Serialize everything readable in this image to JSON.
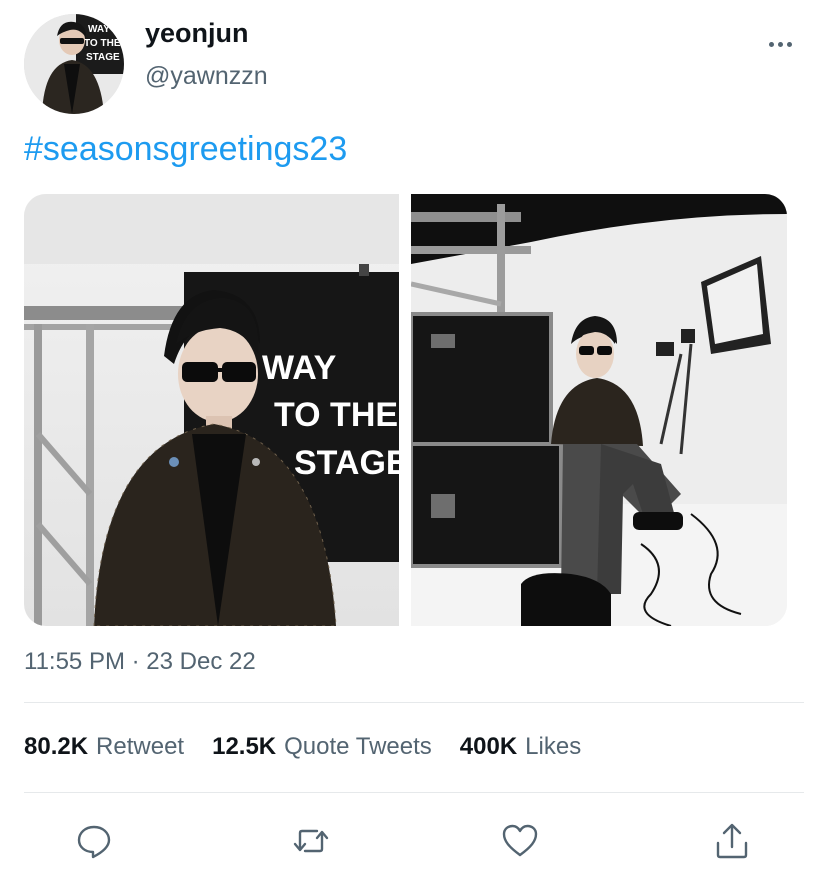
{
  "user": {
    "display_name": "yeonjun",
    "handle": "@yawnzzn",
    "avatar_backdrop_text": [
      "WAY",
      "TO THE",
      "STAGE"
    ]
  },
  "tweet": {
    "text": "#seasonsgreetings23",
    "timestamp": "11:55 PM · 23 Dec 22"
  },
  "media": {
    "photos": [
      {
        "banner_lines": [
          "WAY",
          "TO THE",
          "STAGE"
        ]
      },
      {
        "banner_lines": []
      }
    ]
  },
  "stats": {
    "retweets_count": "80.2K",
    "retweets_label": "Retweet",
    "quotes_count": "12.5K",
    "quotes_label": "Quote Tweets",
    "likes_count": "400K",
    "likes_label": "Likes"
  },
  "actions": {
    "icons": [
      "reply-icon",
      "retweet-icon",
      "like-icon",
      "share-icon"
    ]
  },
  "colors": {
    "link": "#1d9bf0",
    "secondary_text": "#536471",
    "primary_text": "#0f1419",
    "divider": "#e6e9eb"
  }
}
